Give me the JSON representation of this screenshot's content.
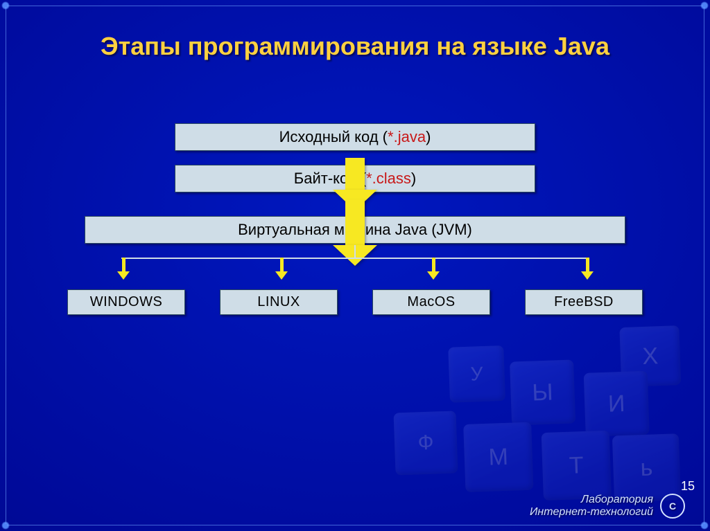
{
  "title": "Этапы программирования на языке Java",
  "source": {
    "label": "Исходный код (",
    "ext": "*.java",
    "close": ")"
  },
  "bytecode": {
    "label": "Байт-код (",
    "ext": "*.class",
    "close": ")"
  },
  "jvm": "Виртуальная машина Java (JVM)",
  "os": [
    "WINDOWS",
    "LINUX",
    "MacOS",
    "FreeBSD"
  ],
  "footer": {
    "line1": "Лаборатория",
    "line2": "Интернет-технологий",
    "logo": "С"
  },
  "page_number": "15",
  "kb_keys": [
    "X",
    "И",
    "Ы",
    "У",
    "Т",
    "М",
    "Ф",
    "ь"
  ]
}
